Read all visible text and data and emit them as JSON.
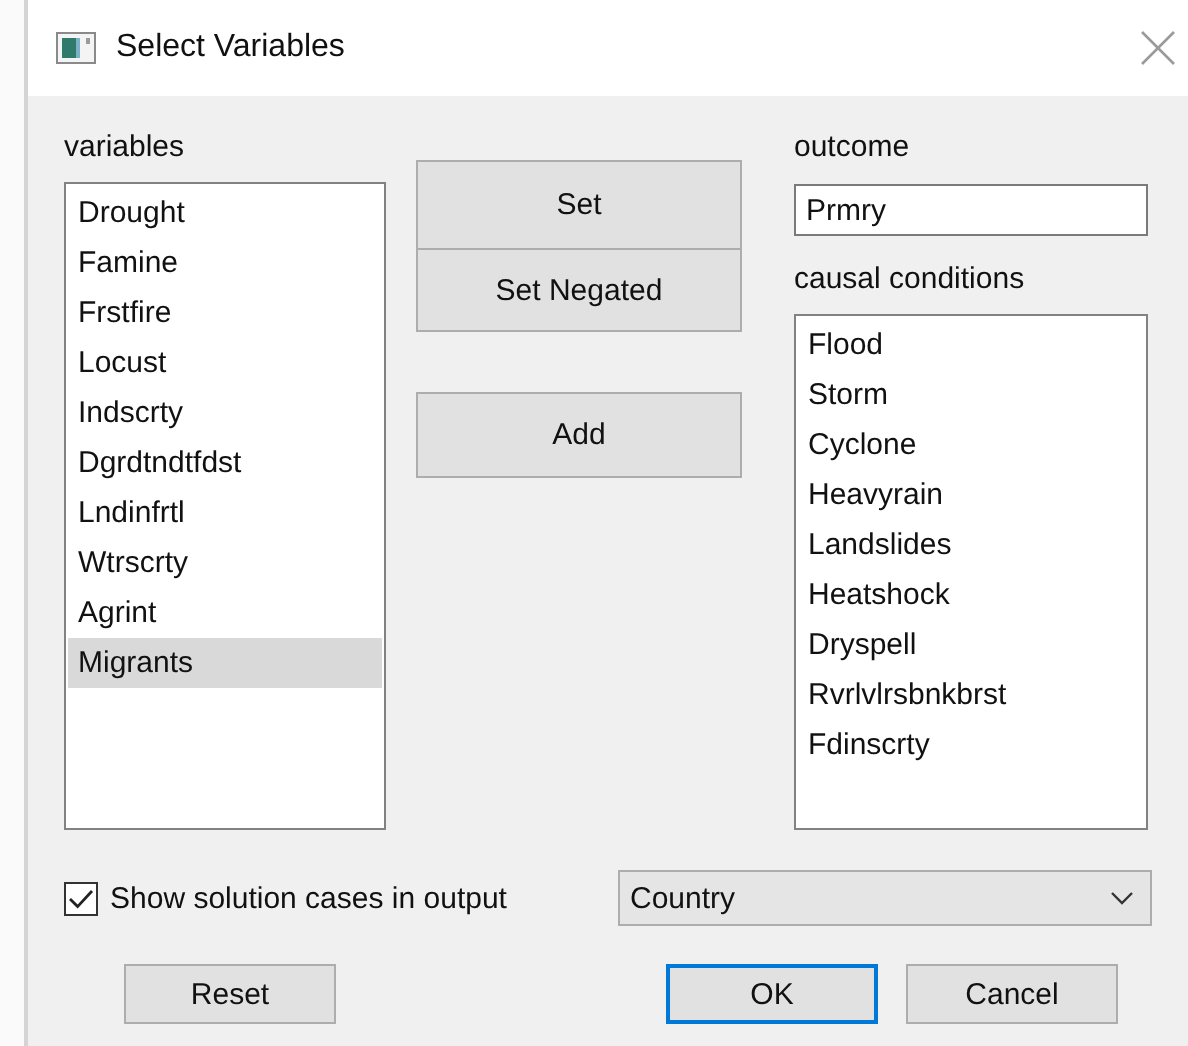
{
  "window": {
    "title": "Select Variables"
  },
  "variables": {
    "label": "variables",
    "items": [
      {
        "label": "Drought",
        "selected": false
      },
      {
        "label": "Famine",
        "selected": false
      },
      {
        "label": "Frstfire",
        "selected": false
      },
      {
        "label": "Locust",
        "selected": false
      },
      {
        "label": "Indscrty",
        "selected": false
      },
      {
        "label": "Dgrdtndtfdst",
        "selected": false
      },
      {
        "label": "Lndinfrtl",
        "selected": false
      },
      {
        "label": "Wtrscrty",
        "selected": false
      },
      {
        "label": "Agrint",
        "selected": false
      },
      {
        "label": "Migrants",
        "selected": true
      }
    ]
  },
  "actions": [
    "Set",
    "Set Negated",
    "Add"
  ],
  "outcome": {
    "label": "outcome",
    "value": "Prmry"
  },
  "causal_conditions": {
    "label": "causal conditions",
    "items": [
      {
        "label": "Flood",
        "selected": false
      },
      {
        "label": "Storm",
        "selected": false
      },
      {
        "label": "Cyclone",
        "selected": false
      },
      {
        "label": "Heavyrain",
        "selected": false
      },
      {
        "label": "Landslides",
        "selected": false
      },
      {
        "label": "Heatshock",
        "selected": false
      },
      {
        "label": "Dryspell",
        "selected": false
      },
      {
        "label": "Rvrlvlrsbnkbrst",
        "selected": false
      },
      {
        "label": "Fdinscrty",
        "selected": false
      }
    ]
  },
  "show_cases": {
    "label": "Show solution cases in output",
    "checked": true
  },
  "case_dropdown": {
    "value": "Country"
  },
  "buttons": [
    {
      "label": "Reset",
      "default": false
    },
    {
      "label": "OK",
      "default": true
    },
    {
      "label": "Cancel",
      "default": false
    }
  ]
}
